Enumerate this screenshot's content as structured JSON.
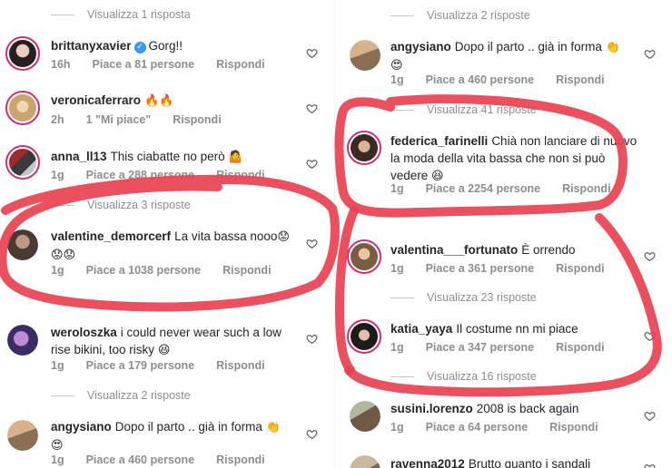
{
  "left": {
    "view_replies_1": "Visualizza 1 risposta",
    "view_replies_3": "Visualizza 3 risposte",
    "view_replies_2": "Visualizza 2 risposte",
    "comments": [
      {
        "user": "brittanyxavier",
        "verified": true,
        "text": "Gorg!!",
        "emoji": "",
        "time": "16h",
        "likes": "Piace a 81 persone",
        "reply": "Rispondi"
      },
      {
        "user": "veronicaferraro",
        "verified": false,
        "text": "",
        "emoji": "🔥🔥",
        "time": "2h",
        "likes": "1 \"Mi piace\"",
        "reply": "Rispondi"
      },
      {
        "user": "anna_ll13",
        "verified": false,
        "text": "This ciabatte no però",
        "emoji": "🤷",
        "time": "1g",
        "likes": "Piace a 288 persone",
        "reply": "Rispondi"
      },
      {
        "user": "valentine_demorcerf",
        "verified": false,
        "text": "La vita bassa nooo",
        "emoji": "😟",
        "emoji2": "😟😟",
        "time": "1g",
        "likes": "Piace a 1038 persone",
        "reply": "Rispondi"
      },
      {
        "user": "weroloszka",
        "verified": false,
        "text": "i could never wear such a low",
        "text2": "rise bikini, too risky",
        "emoji": "😆",
        "time": "1g",
        "likes": "Piace a 179 persone",
        "reply": "Rispondi"
      },
      {
        "user": "angysiano",
        "verified": false,
        "text": "Dopo il parto .. già in forma",
        "emoji": "👏",
        "emoji2": "😍",
        "time": "1g",
        "likes": "Piace a 460 persone",
        "reply": "Rispondi"
      }
    ]
  },
  "right": {
    "view_replies_2": "Visualizza 2 risposte",
    "view_replies_41": "Visualizza 41 risposte",
    "view_replies_23": "Visualizza 23 risposte",
    "view_replies_16": "Visualizza 16 risposte",
    "comments": [
      {
        "user": "angysiano",
        "text": "Dopo il parto .. già in forma",
        "emoji": "👏",
        "emoji2": "😍",
        "time": "1g",
        "likes": "Piace a 460 persone",
        "reply": "Rispondi"
      },
      {
        "user": "federica_farinelli",
        "text": "Chià non lanciare di nuovo",
        "text2": "la moda della vita bassa che non si può",
        "text3": "vedere",
        "emoji": "😆",
        "time": "1g",
        "likes": "Piace a 2254 persone",
        "reply": "Rispondi"
      },
      {
        "user": "valentina___fortunato",
        "text": "È orrendo",
        "time": "1g",
        "likes": "Piace a 361 persone",
        "reply": "Rispondi"
      },
      {
        "user": "katia_yaya",
        "text": "Il costume nn mi piace",
        "time": "1g",
        "likes": "Piace a 347 persone",
        "reply": "Rispondi"
      },
      {
        "user": "susini.lorenzo",
        "text": "2008 is back again",
        "time": "1g",
        "likes": "Piace a 64 persone",
        "reply": "Rispondi"
      },
      {
        "user": "ravenna2012",
        "text": "Brutto quanto i sandali"
      }
    ]
  },
  "colors": {
    "scribble": "#e8414f",
    "muted": "#8e8e8e",
    "verified": "#3897f0",
    "story_ring": "#d62976"
  },
  "icons": [
    "verified-badge-icon",
    "heart-icon"
  ]
}
